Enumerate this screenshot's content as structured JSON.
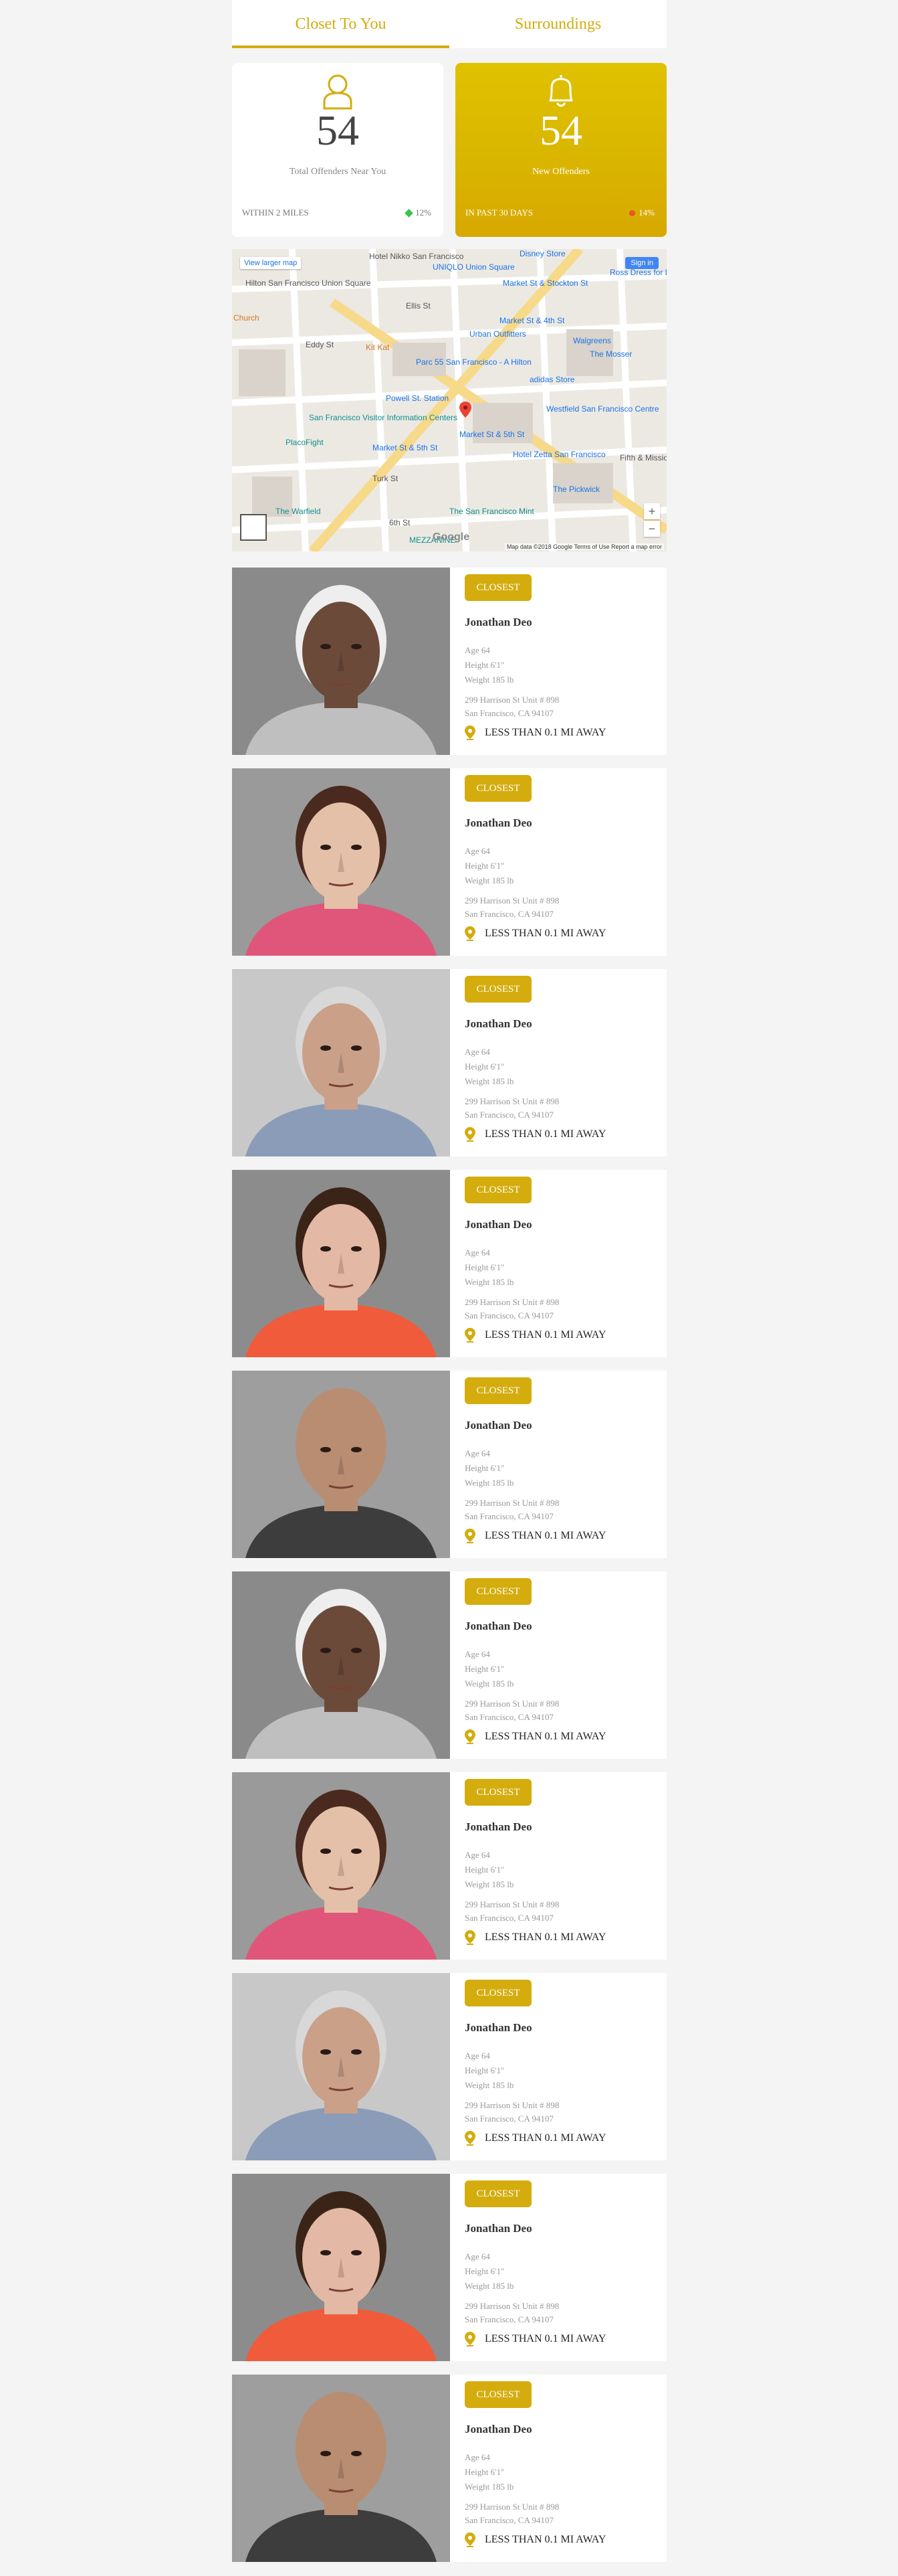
{
  "tabs": [
    {
      "label": "Closet To You",
      "active": true
    },
    {
      "label": "Surroundings",
      "active": false
    }
  ],
  "stats": {
    "total": {
      "value": "54",
      "label": "Total Offenders Near You",
      "footer": "WITHIN 2 MILES",
      "change": "12%",
      "icon": "user-icon"
    },
    "new": {
      "value": "54",
      "label": "New Offenders",
      "footer": "IN PAST 30 DAYS",
      "change": "14%",
      "icon": "bell-icon"
    }
  },
  "map": {
    "view_larger": "View larger map",
    "sign_in": "Sign in",
    "zoom_in": "+",
    "zoom_out": "−",
    "attribution": "Map data ©2018 Google   Terms of Use   Report a map error",
    "logo": "Google",
    "labels": [
      "Hotel Nikko San Francisco",
      "Disney Store",
      "UNIQLO Union Square",
      "Hilton San Francisco Union Square",
      "Market St & Stockton St",
      "Ross Dress for Less",
      "Market St & 4th St",
      "Urban Outfitters",
      "Walgreens",
      "Kit Kat",
      "Parc 55 San Francisco - A Hilton",
      "adidas Store",
      "Powell St. Station",
      "Westfield San Francisco Centre",
      "San Francisco Visitor Information Centers",
      "Market St & 5th St",
      "PlacoFight",
      "Hotel Zetta San Francisco",
      "Market St & 5th St",
      "The Mosser",
      "Turk St",
      "The Pickwick",
      "The Warfield",
      "6th St",
      "The San Francisco Mint",
      "MEZZANINE",
      "Ellis St",
      "Eddy St",
      "Fifth & Mission Garage",
      "Church"
    ]
  },
  "card_labels": {
    "badge": "CLOSEST",
    "distance": "LESS THAN 0.1 MI AWAY"
  },
  "offenders": [
    {
      "name": "Jonathan Deo",
      "age": "Age 64",
      "height": "Height 6'1\"",
      "weight": "Weight 185 lb",
      "address1": "299 Harrison St Unit # 898",
      "address2": "San Francisco, CA 94107",
      "photo": "older man",
      "bg": "#8a8a8a",
      "skin": "#6b4a3a",
      "hair": "#eeeeee",
      "shirt": "#bfbfbf"
    },
    {
      "name": "Jonathan Deo",
      "age": "Age 64",
      "height": "Height 6'1\"",
      "weight": "Weight 185 lb",
      "address1": "299 Harrison St Unit # 898",
      "address2": "San Francisco, CA 94107",
      "photo": "young woman",
      "bg": "#9a9a9a",
      "skin": "#e5c0a8",
      "hair": "#4a2a1e",
      "shirt": "#e0567a"
    },
    {
      "name": "Jonathan Deo",
      "age": "Age 64",
      "height": "Height 6'1\"",
      "weight": "Weight 185 lb",
      "address1": "299 Harrison St Unit # 898",
      "address2": "San Francisco, CA 94107",
      "photo": "gray-haired man",
      "bg": "#c8c8c8",
      "skin": "#caa089",
      "hair": "#d8d8d8",
      "shirt": "#8a9cb8"
    },
    {
      "name": "Jonathan Deo",
      "age": "Age 64",
      "height": "Height 6'1\"",
      "weight": "Weight 185 lb",
      "address1": "299 Harrison St Unit # 898",
      "address2": "San Francisco, CA 94107",
      "photo": "young man",
      "bg": "#8c8c8c",
      "skin": "#e3b8a4",
      "hair": "#3a2418",
      "shirt": "#f05b3c"
    },
    {
      "name": "Jonathan Deo",
      "age": "Age 64",
      "height": "Height 6'1\"",
      "weight": "Weight 185 lb",
      "address1": "299 Harrison St Unit # 898",
      "address2": "San Francisco, CA 94107",
      "photo": "bald man",
      "bg": "#9e9e9e",
      "skin": "#b98d72",
      "hair": "#b98d72",
      "shirt": "#3d3d3d"
    },
    {
      "name": "Jonathan Deo",
      "age": "Age 64",
      "height": "Height 6'1\"",
      "weight": "Weight 185 lb",
      "address1": "299 Harrison St Unit # 898",
      "address2": "San Francisco, CA 94107",
      "photo": "older man",
      "bg": "#8a8a8a",
      "skin": "#6b4a3a",
      "hair": "#eeeeee",
      "shirt": "#bfbfbf"
    },
    {
      "name": "Jonathan Deo",
      "age": "Age 64",
      "height": "Height 6'1\"",
      "weight": "Weight 185 lb",
      "address1": "299 Harrison St Unit # 898",
      "address2": "San Francisco, CA 94107",
      "photo": "young woman",
      "bg": "#9a9a9a",
      "skin": "#e5c0a8",
      "hair": "#4a2a1e",
      "shirt": "#e0567a"
    },
    {
      "name": "Jonathan Deo",
      "age": "Age 64",
      "height": "Height 6'1\"",
      "weight": "Weight 185 lb",
      "address1": "299 Harrison St Unit # 898",
      "address2": "San Francisco, CA 94107",
      "photo": "gray-haired man",
      "bg": "#c8c8c8",
      "skin": "#caa089",
      "hair": "#d8d8d8",
      "shirt": "#8a9cb8"
    },
    {
      "name": "Jonathan Deo",
      "age": "Age 64",
      "height": "Height 6'1\"",
      "weight": "Weight 185 lb",
      "address1": "299 Harrison St Unit # 898",
      "address2": "San Francisco, CA 94107",
      "photo": "young man",
      "bg": "#8c8c8c",
      "skin": "#e3b8a4",
      "hair": "#3a2418",
      "shirt": "#f05b3c"
    },
    {
      "name": "Jonathan Deo",
      "age": "Age 64",
      "height": "Height 6'1\"",
      "weight": "Weight 185 lb",
      "address1": "299 Harrison St Unit # 898",
      "address2": "San Francisco, CA 94107",
      "photo": "bald man",
      "bg": "#9e9e9e",
      "skin": "#b98d72",
      "hair": "#b98d72",
      "shirt": "#3d3d3d"
    }
  ],
  "colors": {
    "accent": "#d4ac0d",
    "page_bg": "#f4f4f4",
    "up": "#3cc24a",
    "down": "#e8571e"
  }
}
